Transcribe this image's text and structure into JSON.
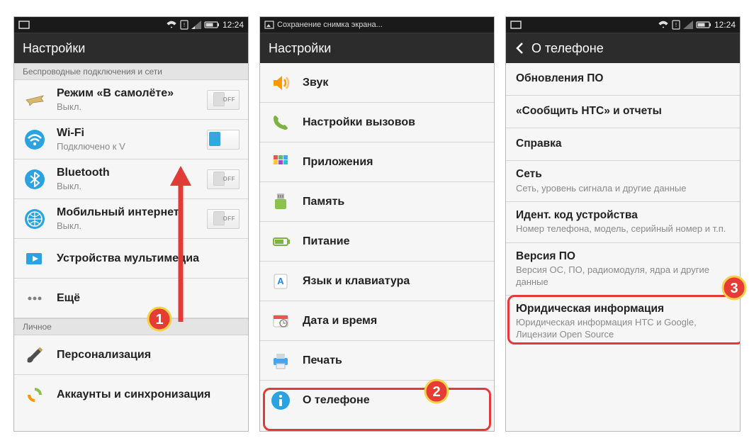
{
  "status": {
    "time": "12:24",
    "screenshot_saving": "Сохранение снимка экрана..."
  },
  "screen1": {
    "header": "Настройки",
    "section_wireless": "Беспроводные подключения и сети",
    "section_personal": "Личное",
    "airplane": {
      "title": "Режим «В самолёте»",
      "sub": "Выкл.",
      "toggle": "OFF"
    },
    "wifi": {
      "title": "Wi-Fi",
      "sub": "Подключено к V",
      "toggle": "ON"
    },
    "bluetooth": {
      "title": "Bluetooth",
      "sub": "Выкл.",
      "toggle": "OFF"
    },
    "mobiledata": {
      "title": "Мобильный интернет",
      "sub": "Выкл.",
      "toggle": "OFF"
    },
    "multimedia": {
      "title": "Устройства мультимедиа"
    },
    "more": {
      "title": "Ещё"
    },
    "personalize": {
      "title": "Персонализация"
    },
    "accounts": {
      "title": "Аккаунты и синхронизация"
    }
  },
  "screen2": {
    "header": "Настройки",
    "sound": "Звук",
    "calls": "Настройки вызовов",
    "apps": "Приложения",
    "storage": "Память",
    "power": "Питание",
    "lang": "Язык и клавиатура",
    "datetime": "Дата и время",
    "print": "Печать",
    "about": "О телефоне"
  },
  "screen3": {
    "header": "О телефоне",
    "upd": {
      "title": "Обновления ПО"
    },
    "tell": {
      "title": "«Сообщить HTC» и отчеты"
    },
    "help": {
      "title": "Справка"
    },
    "net": {
      "title": "Сеть",
      "sub": "Сеть, уровень сигнала и другие данные"
    },
    "ident": {
      "title": "Идент. код устройства",
      "sub": "Номер телефона, модель, серийный номер и т.п."
    },
    "swver": {
      "title": "Версия ПО",
      "sub": "Версия ОС, ПО, радиомодуля, ядра и другие данные"
    },
    "legal": {
      "title": "Юридическая информация",
      "sub": "Юридическая информация HTC и Google, Лицензии Open Source"
    }
  },
  "markers": {
    "m1": "1",
    "m2": "2",
    "m3": "3"
  }
}
